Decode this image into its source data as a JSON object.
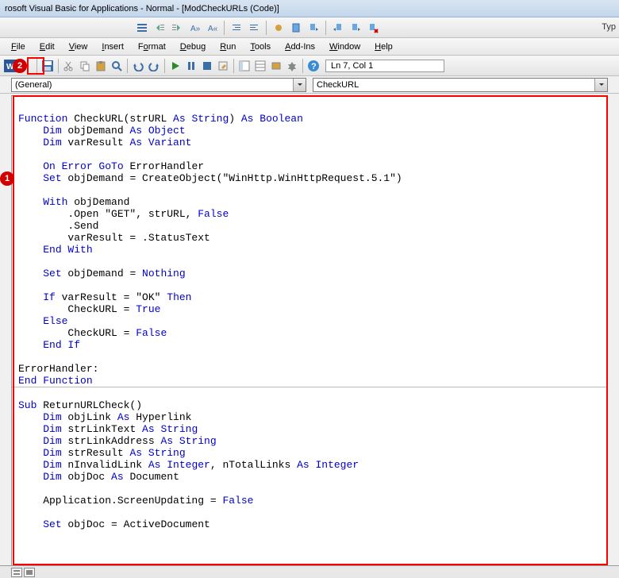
{
  "title": "rosoft Visual Basic for Applications - Normal - [ModCheckURLs (Code)]",
  "typ_label": "Typ",
  "menubar": {
    "file": "File",
    "edit": "Edit",
    "view": "View",
    "insert": "Insert",
    "format": "Format",
    "debug": "Debug",
    "run": "Run",
    "tools": "Tools",
    "addins": "Add-Ins",
    "window": "Window",
    "help": "Help"
  },
  "status": "Ln 7, Col 1",
  "dropdown_left": "(General)",
  "dropdown_right": "CheckURL",
  "callouts": {
    "one": "1",
    "two": "2"
  },
  "code": {
    "l1": "Function CheckURL(strURL As String) As Boolean",
    "l2": "    Dim objDemand As Object",
    "l3": "    Dim varResult As Variant",
    "l4": "",
    "l5": "    On Error GoTo ErrorHandler",
    "l6": "    Set objDemand = CreateObject(\"WinHttp.WinHttpRequest.5.1\")",
    "l7": "",
    "l8": "    With objDemand",
    "l9": "        .Open \"GET\", strURL, False",
    "l10": "        .Send",
    "l11": "        varResult = .StatusText",
    "l12": "    End With",
    "l13": "",
    "l14": "    Set objDemand = Nothing",
    "l15": "",
    "l16": "    If varResult = \"OK\" Then",
    "l17": "        CheckURL = True",
    "l18": "    Else",
    "l19": "        CheckURL = False",
    "l20": "    End If",
    "l21": "",
    "l22": "ErrorHandler:",
    "l23": "End Function",
    "l24": "",
    "l25": "Sub ReturnURLCheck()",
    "l26": "    Dim objLink As Hyperlink",
    "l27": "    Dim strLinkText As String",
    "l28": "    Dim strLinkAddress As String",
    "l29": "    Dim strResult As String",
    "l30": "    Dim nInvalidLink As Integer, nTotalLinks As Integer",
    "l31": "    Dim objDoc As Document",
    "l32": "",
    "l33": "    Application.ScreenUpdating = False",
    "l34": "",
    "l35": "    Set objDoc = ActiveDocument"
  }
}
